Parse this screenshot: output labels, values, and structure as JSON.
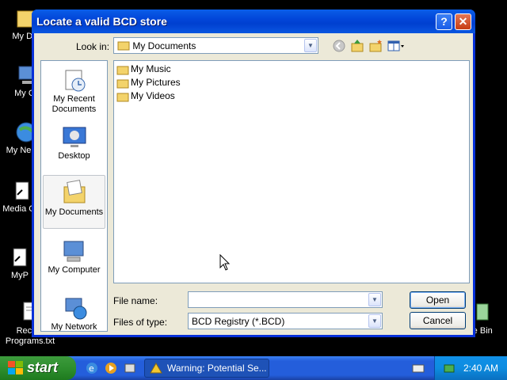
{
  "desktop": {
    "icons": [
      {
        "label": "My Doc"
      },
      {
        "label": "My Co"
      },
      {
        "label": "My Ne Pla"
      },
      {
        "label": "Media Cla"
      },
      {
        "label": "MyP"
      },
      {
        "label": "Recom Programs.txt"
      },
      {
        "label": "le Bin"
      }
    ]
  },
  "dialog": {
    "title": "Locate a valid BCD store",
    "help_label": "?",
    "close_label": "✕",
    "look_in_label": "Look in:",
    "look_in_value": "My Documents",
    "places": [
      {
        "label": "My Recent Documents",
        "icon": "recent-documents-icon"
      },
      {
        "label": "Desktop",
        "icon": "desktop-icon"
      },
      {
        "label": "My Documents",
        "icon": "my-documents-icon"
      },
      {
        "label": "My Computer",
        "icon": "my-computer-icon"
      },
      {
        "label": "My Network",
        "icon": "my-network-icon"
      }
    ],
    "files": [
      {
        "name": "My Music",
        "icon": "folder-icon"
      },
      {
        "name": "My Pictures",
        "icon": "folder-icon"
      },
      {
        "name": "My Videos",
        "icon": "folder-icon"
      }
    ],
    "file_name_label": "File name:",
    "file_name_value": "",
    "files_of_type_label": "Files of type:",
    "files_of_type_value": "BCD Registry (*.BCD)",
    "open_label": "Open",
    "cancel_label": "Cancel"
  },
  "taskbar": {
    "start_label": "start",
    "task_label": "Warning: Potential Se...",
    "clock": "2:40 AM"
  }
}
